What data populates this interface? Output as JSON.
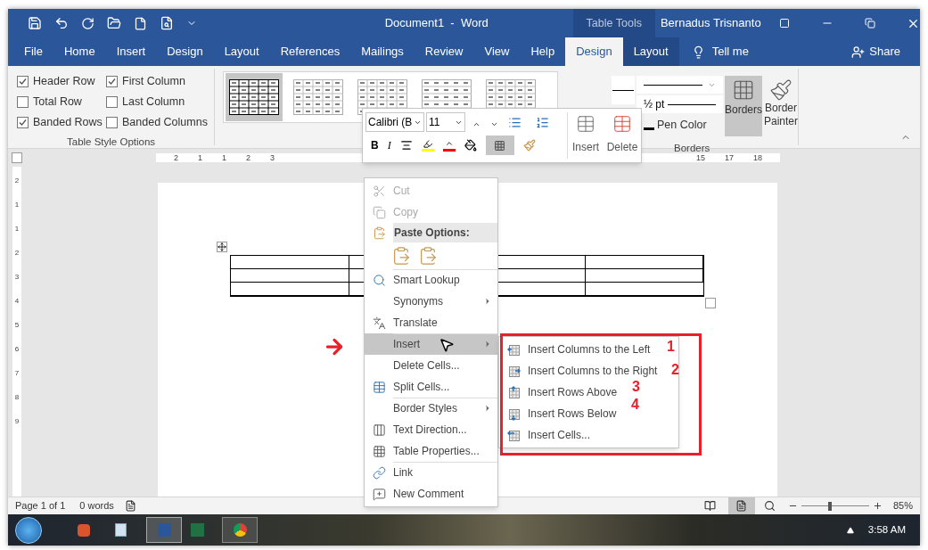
{
  "title_bar": {
    "title": "Document1  -  Word",
    "contextual_label": "Table Tools",
    "user": "Bernadus Trisnanto"
  },
  "tabs": [
    {
      "label": "File",
      "selected": false,
      "contextual": false
    },
    {
      "label": "Home",
      "selected": false,
      "contextual": false
    },
    {
      "label": "Insert",
      "selected": false,
      "contextual": false
    },
    {
      "label": "Design",
      "selected": false,
      "contextual": false
    },
    {
      "label": "Layout",
      "selected": false,
      "contextual": false
    },
    {
      "label": "References",
      "selected": false,
      "contextual": false
    },
    {
      "label": "Mailings",
      "selected": false,
      "contextual": false
    },
    {
      "label": "Review",
      "selected": false,
      "contextual": false
    },
    {
      "label": "View",
      "selected": false,
      "contextual": false
    },
    {
      "label": "Help",
      "selected": false,
      "contextual": false
    },
    {
      "label": "Design",
      "selected": true,
      "contextual": true
    },
    {
      "label": "Layout",
      "selected": false,
      "contextual": true
    }
  ],
  "tell_me": "Tell me",
  "share": "Share",
  "table_style_options": {
    "group_label": "Table Style Options",
    "checkboxes": [
      {
        "label": "Header Row",
        "checked": true
      },
      {
        "label": "First Column",
        "checked": true
      },
      {
        "label": "Total Row",
        "checked": false
      },
      {
        "label": "Last Column",
        "checked": false
      },
      {
        "label": "Banded Rows",
        "checked": true
      },
      {
        "label": "Banded Columns",
        "checked": false
      }
    ]
  },
  "gallery": [
    {
      "selected": true
    },
    {
      "selected": false
    },
    {
      "selected": false
    },
    {
      "selected": false
    },
    {
      "selected": false
    }
  ],
  "borders_group": {
    "group_label": "Borders",
    "line_weight": "½ pt",
    "pen_color": "Pen Color",
    "borders": "Borders",
    "border_painter": "Border Painter"
  },
  "ruler": {
    "left_labels": [
      "2",
      "1",
      "1",
      "2",
      "3"
    ],
    "right_labels": [
      "15",
      "17",
      "18"
    ]
  },
  "vertical_ruler": [
    "2",
    "1",
    "1",
    "2",
    "3",
    "4",
    "5",
    "6",
    "7",
    "8",
    "9"
  ],
  "mini_toolbar": {
    "font": "Calibri (B",
    "size": "11",
    "bold": "B",
    "italic": "I",
    "insert": "Insert",
    "delete": "Delete"
  },
  "context_menu": [
    {
      "kind": "item",
      "label": "Cut",
      "disabled": true,
      "selected": false,
      "submenu": false,
      "separator": false
    },
    {
      "kind": "item",
      "label": "Copy",
      "disabled": true,
      "selected": false,
      "submenu": false,
      "separator": false
    },
    {
      "kind": "header",
      "label": "Paste Options:"
    },
    {
      "kind": "paste_icons"
    },
    {
      "kind": "item",
      "label": "Smart Lookup",
      "disabled": false,
      "selected": false,
      "submenu": false,
      "separator": true
    },
    {
      "kind": "item",
      "label": "Synonyms",
      "disabled": false,
      "selected": false,
      "submenu": true,
      "separator": false
    },
    {
      "kind": "item",
      "label": "Translate",
      "disabled": false,
      "selected": false,
      "submenu": false,
      "separator": false
    },
    {
      "kind": "item",
      "label": "Insert",
      "disabled": false,
      "selected": true,
      "submenu": true,
      "separator": true
    },
    {
      "kind": "item",
      "label": "Delete Cells...",
      "disabled": false,
      "selected": false,
      "submenu": false,
      "separator": false
    },
    {
      "kind": "item",
      "label": "Split Cells...",
      "disabled": false,
      "selected": false,
      "submenu": false,
      "separator": false
    },
    {
      "kind": "item",
      "label": "Border Styles",
      "disabled": false,
      "selected": false,
      "submenu": true,
      "separator": true
    },
    {
      "kind": "item",
      "label": "Text Direction...",
      "disabled": false,
      "selected": false,
      "submenu": false,
      "separator": false
    },
    {
      "kind": "item",
      "label": "Table Properties...",
      "disabled": false,
      "selected": false,
      "submenu": false,
      "separator": false
    },
    {
      "kind": "item",
      "label": "Link",
      "disabled": false,
      "selected": false,
      "submenu": false,
      "separator": true
    },
    {
      "kind": "item",
      "label": "New Comment",
      "disabled": false,
      "selected": false,
      "submenu": false,
      "separator": false
    }
  ],
  "submenu": [
    {
      "label": "Insert Columns to the Left",
      "annotation": "1"
    },
    {
      "label": "Insert Columns to the Right",
      "annotation": "2"
    },
    {
      "label": "Insert Rows Above",
      "annotation": "3"
    },
    {
      "label": "Insert Rows Below",
      "annotation": "4"
    },
    {
      "label": "Insert Cells..."
    }
  ],
  "status_bar": {
    "page": "Page 1 of 1",
    "words": "0 words",
    "zoom": "85%",
    "zoom_slider": {
      "level": 0.42
    }
  },
  "taskbar": {
    "clock": "3:58 AM"
  }
}
